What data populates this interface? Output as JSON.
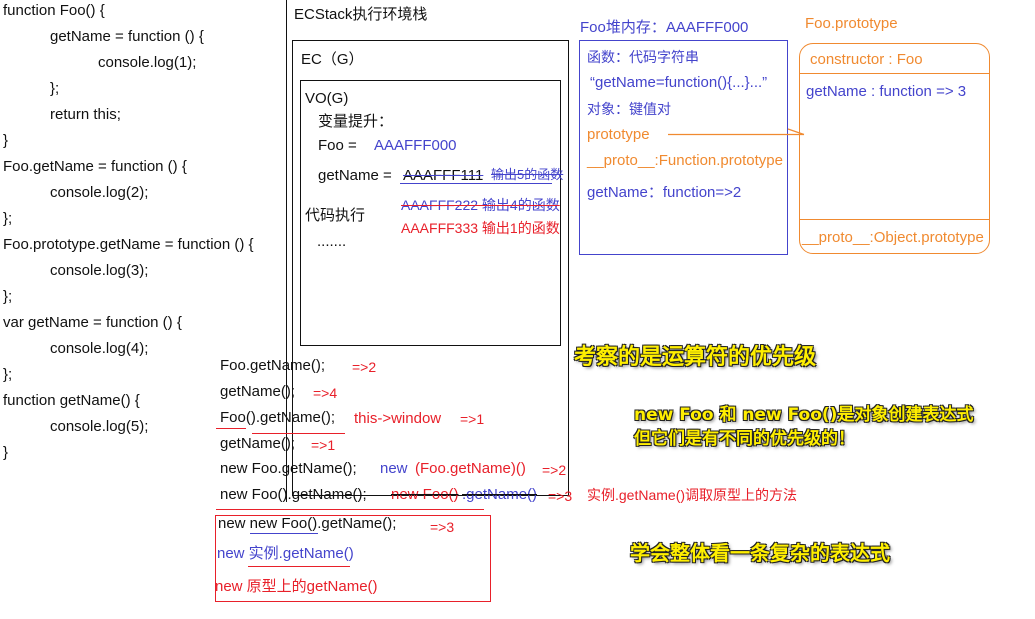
{
  "code": {
    "lines": [
      "function Foo() {",
      "getName = function () {",
      "console.log(1);",
      "};",
      "return this;",
      "}",
      "Foo.getName = function () {",
      "console.log(2);",
      "};",
      "Foo.prototype.getName = function () {",
      "console.log(3);",
      "};",
      "var getName = function () {",
      "console.log(4);",
      "};",
      "function getName() {",
      "console.log(5);",
      "}"
    ]
  },
  "ecstack": {
    "title": "ECStack执行环境栈",
    "ec_label": "EC（G）",
    "vo_label": "VO(G)",
    "hoist_label": "变量提升：",
    "foo_label": "Foo  =",
    "foo_value": "AAAFFF000",
    "getname_label": "getName =",
    "getname_v1": "AAAFFF111",
    "getname_v1_note": "输出5的函数",
    "getname_v2": "AAAFFF222 输出4的函数",
    "getname_v3": "AAAFFF333 输出1的函数",
    "exec_label": "代码执行",
    "exec_dots": "......."
  },
  "heap": {
    "title": "Foo堆内存：AAAFFF000",
    "func_label": "函数：代码字符串",
    "func_code": "“getName=function(){...}...”",
    "obj_label": "对象：键值对",
    "prototype": "prototype",
    "proto": "__proto__:Function.prototype",
    "getname": "getName：function=>2"
  },
  "prototype_obj": {
    "title": "Foo.prototype",
    "constructor": "constructor : Foo",
    "getname": "getName : function => 3",
    "proto": "__proto__:Object.prototype"
  },
  "calls": [
    {
      "code": "Foo.getName();",
      "note": "",
      "result": "=>2"
    },
    {
      "code": "getName();",
      "note": "",
      "result": "=>4"
    },
    {
      "code": "Foo().getName();",
      "note": "this->window",
      "result": "=>1"
    },
    {
      "code": "getName();",
      "note": "",
      "result": "=>1"
    },
    {
      "code": "new Foo.getName();",
      "note_blue": "new",
      "note_red": "(Foo.getName)()",
      "note_blue2": "",
      "result": "=>2"
    },
    {
      "code": "new Foo().getName();",
      "note_red": "new Foo()",
      "note_blue": ".getName()",
      "result": "=>3",
      "extra": "实例.getName()调取原型上的方法"
    }
  ],
  "boxed": {
    "line1": "new new Foo().getName();",
    "line1_result": "=>3",
    "line2": "new 实例.getName()",
    "line3": "new 原型上的getName()"
  },
  "callouts": {
    "c1": "考察的是运算符的优先级",
    "c2a": "new Foo 和 new Foo()是对象创建表达式",
    "c2b": "但它们是有不同的优先级的！",
    "c3": "学会整体看一条复杂的表达式"
  },
  "colors": {
    "blue": "#4444cc",
    "red": "#e8202a",
    "orange": "#f08a30",
    "callout": "#ffef00"
  }
}
